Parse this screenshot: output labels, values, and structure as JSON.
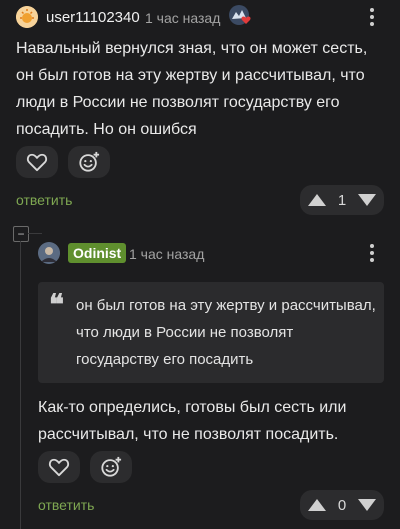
{
  "comment": {
    "author": "user11102340",
    "time": "1 час назад",
    "text": "Навальный вернулся зная, что он может сесть, он был готов на эту жертву и рассчитывал, что люди в России не позволят государству его посадить. Но он ошибся",
    "reply_label": "ответить",
    "rating": "1",
    "avatar_icon": "sun-avatar-icon",
    "badge_icon": "heart-badge-icon"
  },
  "reply": {
    "author": "Odinist",
    "time": "1 час назад",
    "quote": "он был готов на эту жертву и рассчитывал, что люди в России не позволят государству его посадить",
    "text": "Как-то определись, готовы был сесть или рассчитывал, что не позволят посадить.",
    "reply_label": "ответить",
    "rating": "0",
    "avatar_icon": "portrait-avatar-icon",
    "collapse_symbol": "−"
  },
  "colors": {
    "background": "#1c1c1e",
    "accent_green": "#7fa852",
    "badge_green": "#5f8f2e",
    "heart_red": "#e23b3b"
  }
}
